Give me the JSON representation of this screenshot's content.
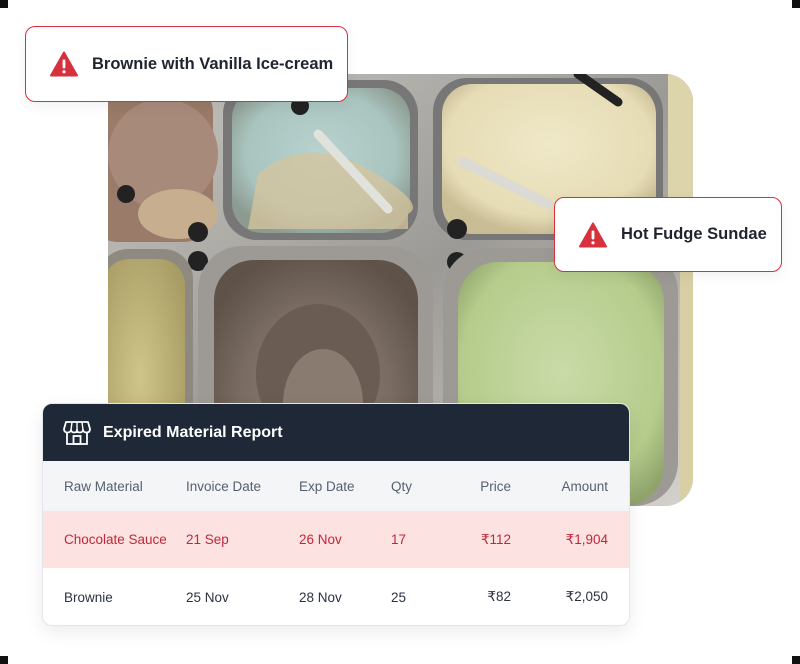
{
  "alerts": [
    {
      "label": "Brownie with Vanilla Ice-cream"
    },
    {
      "label": "Hot Fudge Sundae"
    }
  ],
  "photo": {
    "description_icon": "ice-cream-tubs-photo"
  },
  "report": {
    "title": "Expired Material Report",
    "icon": "store-icon",
    "columns": [
      "Raw Material",
      "Invoice Date",
      "Exp Date",
      "Qty",
      "Price",
      "Amount"
    ],
    "rows": [
      {
        "material": "Chocolate Sauce",
        "invoice_date": "21 Sep",
        "exp_date": "26 Nov",
        "qty": "17",
        "price": "₹112",
        "amount": "₹1,904",
        "status": "expired"
      },
      {
        "material": "Brownie",
        "invoice_date": "25 Nov",
        "exp_date": "28 Nov",
        "qty": "25",
        "price": "₹82",
        "amount": "₹2,050",
        "status": "normal"
      }
    ]
  },
  "colors": {
    "alert_border": "#d6323e",
    "warning_icon": "#d6323e",
    "header_bg": "#1e2837",
    "expired_row_bg": "#fde2e2",
    "expired_text": "#c0283a"
  }
}
